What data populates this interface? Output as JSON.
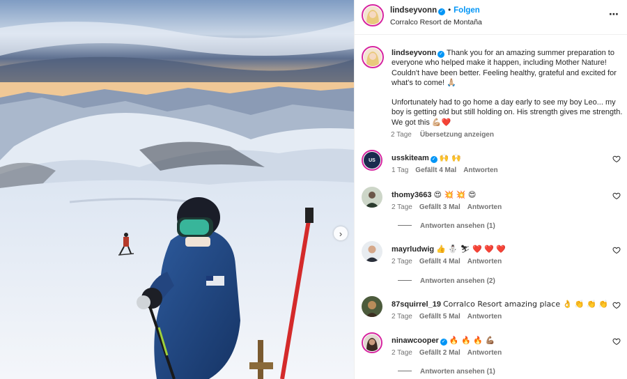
{
  "header": {
    "username": "lindseyvonn",
    "separator": "•",
    "follow_label": "Folgen",
    "location": "Corralco Resort de Montaña",
    "more_icon": "⋯"
  },
  "media": {
    "next_icon": "›",
    "description_colors": {
      "sky_top": "#8fa8c8",
      "sunset": "#f3c88b",
      "snow": "#eef2f8",
      "jacket": "#1f3f7a"
    }
  },
  "caption": {
    "username": "lindseyvonn",
    "paragraph1": "Thank you for an amazing summer preparation to everyone who helped make it happen, including Mother Nature! Couldn't have been better. Feeling healthy, grateful and excited for what's to come! 🙏🏼",
    "paragraph2": "Unfortunately had to go home a day early to see my boy Leo... my boy is getting old but still holding on. His strength gives me strength. We got this 💪🏼❤️",
    "time": "2 Tage",
    "translate_label": "Übersetzung anzeigen"
  },
  "comments": [
    {
      "username": "usskiteam",
      "text": "🙌 🙌",
      "time": "1 Tag",
      "likes": "Gefällt 4 Mal",
      "reply": "Antworten",
      "verified": true,
      "replies_label": ""
    },
    {
      "username": "thomy3663",
      "text": "😍 💥 💥 😍",
      "time": "2 Tage",
      "likes": "Gefällt 3 Mal",
      "reply": "Antworten",
      "verified": false,
      "replies_label": "Antworten ansehen (1)"
    },
    {
      "username": "mayrludwig",
      "text": "👍 ⛄ ⛷ ❤️ ❤️ ❤️",
      "time": "2 Tage",
      "likes": "Gefällt 4 Mal",
      "reply": "Antworten",
      "verified": false,
      "replies_label": "Antworten ansehen (2)"
    },
    {
      "username": "87squirrel_19",
      "text": "Corralco Resort amazing place 👌 👏 👏 👏",
      "time": "2 Tage",
      "likes": "Gefällt 5 Mal",
      "reply": "Antworten",
      "verified": false,
      "replies_label": ""
    },
    {
      "username": "ninawcooper",
      "text": "🔥 🔥 🔥 💪🏽",
      "time": "2 Tage",
      "likes": "Gefällt 2 Mal",
      "reply": "Antworten",
      "verified": true,
      "replies_label": "Antworten ansehen (1)"
    }
  ],
  "ui": {
    "verified_glyph": "✓",
    "avatar_text_usski": "US"
  }
}
